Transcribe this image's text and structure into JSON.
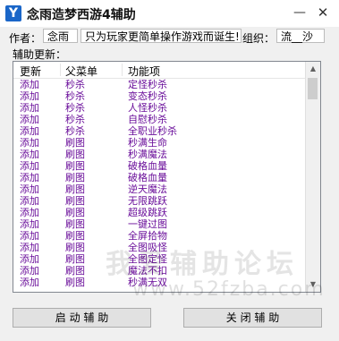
{
  "window": {
    "icon": "Y",
    "title": "念雨造梦西游4辅助",
    "minimize_glyph": "—",
    "close_glyph": "✕"
  },
  "info": {
    "author_label": "作者：",
    "author_value": "念雨",
    "slogan": "只为玩家更简单操作游戏而诞生!",
    "org_label": "组织：",
    "org_value": "流__沙"
  },
  "updates": {
    "label": "辅助更新：",
    "columns": [
      "更新",
      "父菜单",
      "功能项"
    ],
    "rows": [
      [
        "添加",
        "秒杀",
        "定怪秒杀"
      ],
      [
        "添加",
        "秒杀",
        "变态秒杀"
      ],
      [
        "添加",
        "秒杀",
        "人怪秒杀"
      ],
      [
        "添加",
        "秒杀",
        "自慰秒杀"
      ],
      [
        "添加",
        "秒杀",
        "全职业秒杀"
      ],
      [
        "添加",
        "刷图",
        "秒满生命"
      ],
      [
        "添加",
        "刷图",
        "秒满魔法"
      ],
      [
        "添加",
        "刷图",
        "破格血量"
      ],
      [
        "添加",
        "刷图",
        "破格血量"
      ],
      [
        "添加",
        "刷图",
        "逆天魔法"
      ],
      [
        "添加",
        "刷图",
        "无限跳跃"
      ],
      [
        "添加",
        "刷图",
        "超级跳跃"
      ],
      [
        "添加",
        "刷图",
        "一键过图"
      ],
      [
        "添加",
        "刷图",
        "全屏拾物"
      ],
      [
        "添加",
        "刷图",
        "全图吸怪"
      ],
      [
        "添加",
        "刷图",
        "全图定怪"
      ],
      [
        "添加",
        "刷图",
        "魔法不扣"
      ],
      [
        "添加",
        "刷图",
        "秒满无双"
      ]
    ],
    "text_color": "#6a0e9a"
  },
  "buttons": {
    "start": "启 动 辅 助",
    "close": "关 闭 辅 助"
  },
  "watermark": {
    "text": "我爱辅助论坛",
    "url": "www.52fzba.com"
  }
}
